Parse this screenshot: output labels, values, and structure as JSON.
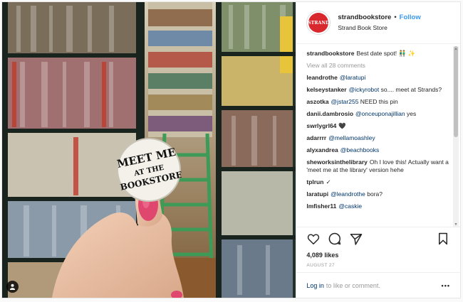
{
  "post": {
    "username": "strandbookstore",
    "follow_label": "Follow",
    "dot": "•",
    "location": "Strand Book Store",
    "avatar_text": "STRAND"
  },
  "photo": {
    "button_line1": "MEET ME",
    "button_line2": "AT THE",
    "button_line3": "BOOKSTORE"
  },
  "caption": {
    "user": "strandbookstore",
    "text": "Best date spot! 👬 ✨"
  },
  "view_all": "View all 28 comments",
  "comments": [
    {
      "user": "leandrothe",
      "text": "",
      "mention": "@laratupi",
      "after": ""
    },
    {
      "user": "kelseystanker",
      "text": "",
      "mention": "@ickyrobot",
      "after": " so.... meet at Strands?"
    },
    {
      "user": "aszotka",
      "text": "",
      "mention": "@jstar255",
      "after": " NEED this pin"
    },
    {
      "user": "danii.dambrosio",
      "text": "",
      "mention": "@onceuponajillian",
      "after": " yes"
    },
    {
      "user": "swrlygrl64",
      "text": "🖤",
      "mention": "",
      "after": ""
    },
    {
      "user": "adarrrr",
      "text": "",
      "mention": "@mellamoashley",
      "after": ""
    },
    {
      "user": "alyxandrea",
      "text": "",
      "mention": "@beachbooks",
      "after": ""
    },
    {
      "user": "sheworksinthelibrary",
      "text": "Oh I love this! Actually want a 'meet me at the library' version hehe",
      "mention": "",
      "after": ""
    },
    {
      "user": "tplrun",
      "text": "✓",
      "mention": "",
      "after": ""
    },
    {
      "user": "laratupi",
      "text": "",
      "mention": "@leandrothe",
      "after": " bora?"
    },
    {
      "user": "lmfisher11",
      "text": "",
      "mention": "@caskie",
      "after": ""
    }
  ],
  "likes": "4,089 likes",
  "date": "August 27",
  "footer": {
    "login": "Log in",
    "rest": "to like or comment.",
    "more": "•••"
  },
  "icons": {
    "like": "heart-icon",
    "comment": "comment-icon",
    "share": "share-icon",
    "save": "bookmark-icon",
    "tag": "user-tag-icon"
  },
  "colors": {
    "follow": "#3897f0",
    "mention": "#003569",
    "strand_red": "#d9272e"
  }
}
